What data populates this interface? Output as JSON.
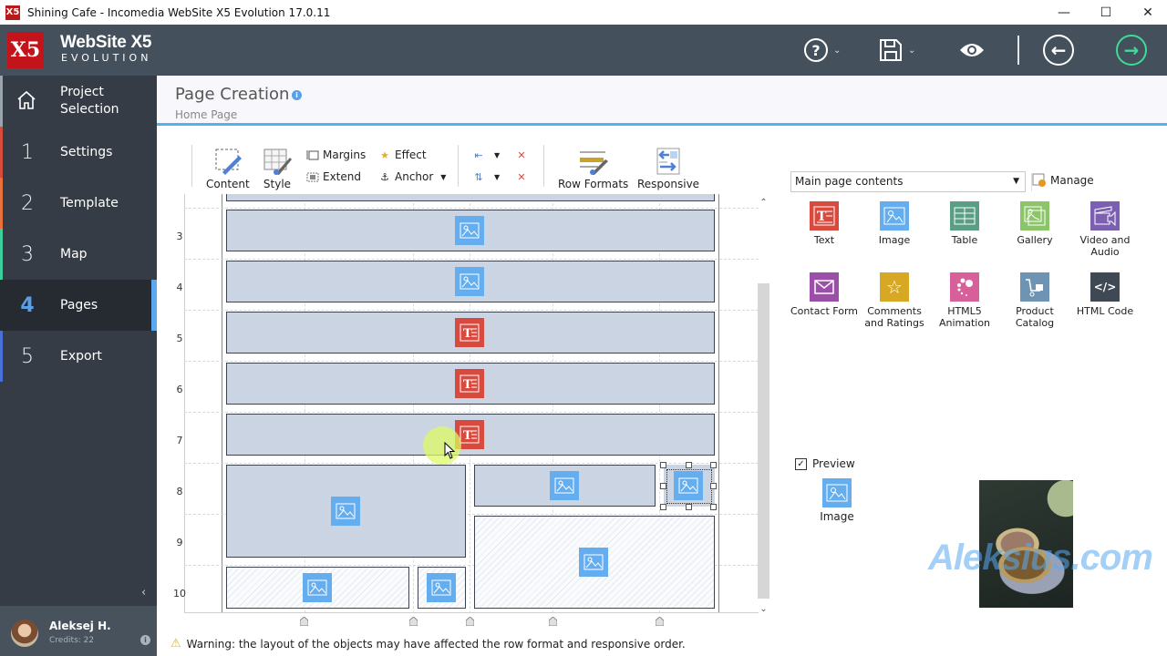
{
  "window": {
    "title": "Shining Cafe - Incomedia WebSite X5 Evolution 17.0.11",
    "controls": [
      "minimize",
      "maximize",
      "close"
    ]
  },
  "header": {
    "logo_line1": "WebSite X5",
    "logo_line2": "EVOLUTION",
    "buttons": [
      {
        "name": "help",
        "icon": "question-circle-icon",
        "has_dropdown": true
      },
      {
        "name": "save",
        "icon": "floppy-disk-icon",
        "has_dropdown": true
      },
      {
        "name": "preview",
        "icon": "eye-icon"
      },
      {
        "name": "back",
        "icon": "arrow-left-circle-icon"
      },
      {
        "name": "next",
        "icon": "arrow-right-circle-icon",
        "color": "#3ddc97"
      }
    ]
  },
  "sidebar": {
    "items": [
      {
        "num": "",
        "icon": "home-icon",
        "label": "Project Selection",
        "stripe": "#9aa4ad"
      },
      {
        "num": "1",
        "label": "Settings",
        "stripe": "#d64b3c"
      },
      {
        "num": "2",
        "label": "Template",
        "stripe": "#e8703a"
      },
      {
        "num": "3",
        "label": "Map",
        "stripe": "#3ccf9a"
      },
      {
        "num": "4",
        "label": "Pages",
        "stripe": "#5aa9f0",
        "active": true
      },
      {
        "num": "5",
        "label": "Export",
        "stripe": "#4a6fd8"
      }
    ],
    "user": {
      "name": "Aleksej H.",
      "credits": "Credits: 22"
    }
  },
  "page": {
    "title": "Page Creation",
    "breadcrumb": "Home Page"
  },
  "toolbar": {
    "content": "Content",
    "style": "Style",
    "margins": "Margins",
    "extend": "Extend",
    "effect": "Effect",
    "anchor": "Anchor",
    "row_formats": "Row Formats",
    "responsive": "Responsive"
  },
  "grid": {
    "row_labels": [
      "3",
      "4",
      "5",
      "6",
      "7",
      "8",
      "9",
      "10"
    ],
    "objects": [
      {
        "row": "3",
        "type": "image"
      },
      {
        "row": "4",
        "type": "image"
      },
      {
        "row": "5",
        "type": "text"
      },
      {
        "row": "6",
        "type": "text"
      },
      {
        "row": "7",
        "type": "text"
      },
      {
        "row": "8-9",
        "type": "image"
      },
      {
        "row": "8",
        "type": "image"
      },
      {
        "row": "8",
        "type": "image",
        "selected": true
      },
      {
        "row": "9-10",
        "type": "image",
        "empty_cell": true
      },
      {
        "row": "10",
        "type": "image",
        "empty_cell": true
      },
      {
        "row": "10",
        "type": "image",
        "empty_cell": true
      }
    ],
    "warning": "Warning: the layout of the objects may have affected the row format and responsive order."
  },
  "right_panel": {
    "category": "Main page contents",
    "manage_label": "Manage",
    "objects": [
      {
        "label": "Text",
        "icon": "text-object-icon",
        "color": "#d84a3e"
      },
      {
        "label": "Image",
        "icon": "image-object-icon",
        "color": "#64aef0"
      },
      {
        "label": "Table",
        "icon": "table-object-icon",
        "color": "#5a9e85"
      },
      {
        "label": "Gallery",
        "icon": "gallery-object-icon",
        "color": "#8cc46a"
      },
      {
        "label": "Video and Audio",
        "icon": "video-audio-object-icon",
        "color": "#7b5fb0"
      },
      {
        "label": "Contact Form",
        "icon": "envelope-icon",
        "color": "#9b4fa8"
      },
      {
        "label": "Comments and Ratings",
        "icon": "star-icon",
        "color": "#d6a824"
      },
      {
        "label": "HTML5 Animation",
        "icon": "animation-dots-icon",
        "color": "#d8609a"
      },
      {
        "label": "Product Catalog",
        "icon": "cart-icon",
        "color": "#6f93b3"
      },
      {
        "label": "HTML Code",
        "icon": "code-icon",
        "color": "#3f4954"
      }
    ],
    "preview_label": "Preview",
    "preview_checked": true,
    "selected_object": "Image"
  },
  "watermark": "Aleksius.com"
}
